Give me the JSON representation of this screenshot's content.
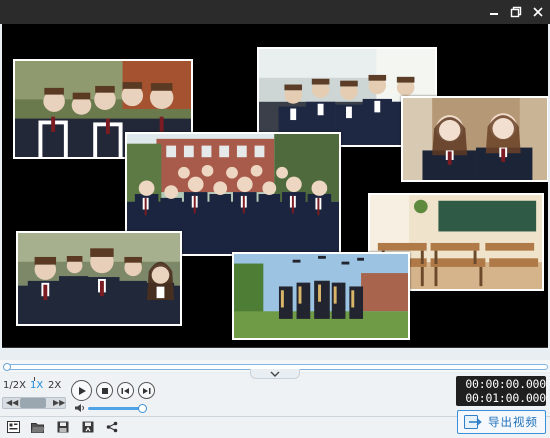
{
  "window": {
    "controls": [
      {
        "name": "minimize-icon"
      },
      {
        "name": "restore-icon"
      },
      {
        "name": "close-icon"
      }
    ]
  },
  "preview": {
    "photos": [
      {
        "name": "photo-students-group-left",
        "palette": [
          "#5a6b3f",
          "#2a2f3c",
          "#d9c3a5"
        ]
      },
      {
        "name": "photo-students-classroom-top",
        "palette": [
          "#cfd8d6",
          "#1f2a40",
          "#e8d9c4"
        ]
      },
      {
        "name": "photo-girls-right",
        "palette": [
          "#9a7d60",
          "#1d2438",
          "#f0e2d2"
        ]
      },
      {
        "name": "photo-class-center",
        "palette": [
          "#a0564a",
          "#1c2540",
          "#e6d3bf"
        ]
      },
      {
        "name": "photo-classroom-desks",
        "palette": [
          "#e3d6be",
          "#9c6b3f",
          "#355c45"
        ]
      },
      {
        "name": "photo-students-group-bottom-left",
        "palette": [
          "#6d7a58",
          "#20283a",
          "#e0c8ae"
        ]
      },
      {
        "name": "photo-graduation",
        "palette": [
          "#8fb6d8",
          "#2d2f3a",
          "#6f9a4a"
        ]
      }
    ]
  },
  "playback": {
    "speeds": [
      "1/2X",
      "1X",
      "2X"
    ],
    "active_speed": "1X",
    "speed_level": 0.5,
    "volume_level": 0.92,
    "progress": 0.0,
    "current_time": "00:00:00.000",
    "total_time": "00:01:00.000"
  },
  "toolbar": {
    "icons": [
      "new-project-icon",
      "open-folder-icon",
      "save-icon",
      "save-as-icon",
      "share-icon"
    ],
    "export_label": "导出视频"
  },
  "colors": {
    "accent": "#1e88d8",
    "titlebar": "#2b2b2b",
    "preview_bg": "#000000",
    "panel_bg": "#eef2f5"
  }
}
